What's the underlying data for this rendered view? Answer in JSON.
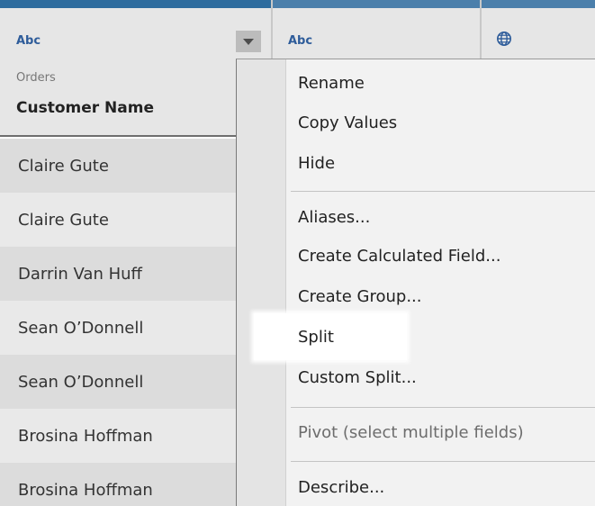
{
  "columns": [
    {
      "type_label": "Abc",
      "source": "Orders",
      "field_name": "Customer Name"
    },
    {
      "type_label": "Abc"
    },
    {
      "type_icon": "globe-icon"
    }
  ],
  "rows": [
    "Claire Gute",
    "Claire Gute",
    "Darrin Van Huff",
    "Sean O’Donnell",
    "Sean O’Donnell",
    "Brosina Hoffman",
    "Brosina Hoffman"
  ],
  "context_menu": {
    "items": [
      "Rename",
      "Copy Values",
      "Hide",
      "Aliases...",
      "Create Calculated Field...",
      "Create Group...",
      "Split",
      "Custom Split...",
      "Pivot (select multiple fields)",
      "Describe..."
    ],
    "highlighted_item": "Split",
    "disabled_item": "Pivot (select multiple fields)"
  },
  "colors": {
    "accent_bar": "#2e6c9e",
    "type_label": "#2e5c9a",
    "menu_background": "#f2f2f2"
  }
}
